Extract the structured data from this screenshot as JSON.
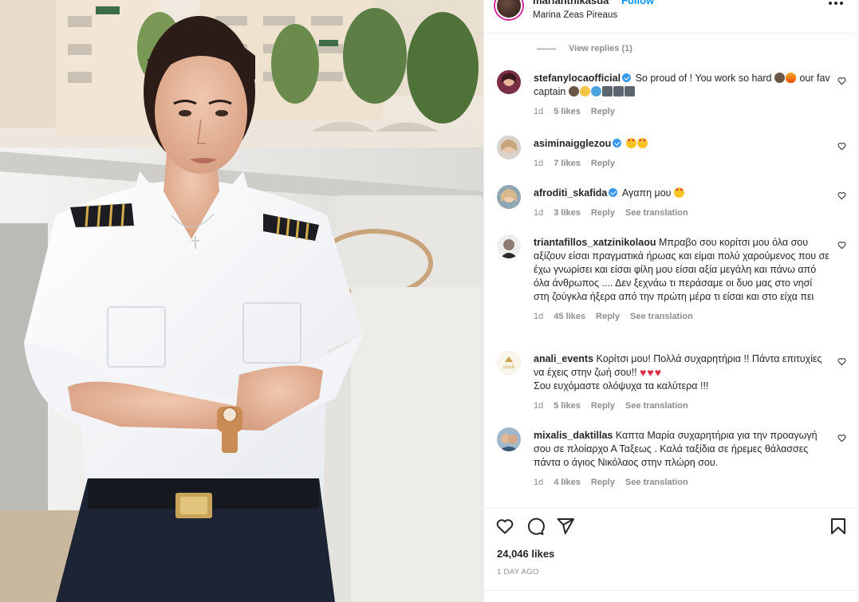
{
  "post": {
    "username": "marianthikasda",
    "follow_label": "Follow",
    "location": "Marina Zeas Pireaus"
  },
  "view_replies": "View replies (1)",
  "comments": [
    {
      "user": "stefanylocaofficial",
      "verified": true,
      "text": "So proud of ! You work so hard",
      "text_after": "our fav captain",
      "time": "1d",
      "likes": "5 likes",
      "reply": "Reply",
      "translation": ""
    },
    {
      "user": "asiminaigglezou",
      "verified": true,
      "text": "",
      "time": "1d",
      "likes": "7 likes",
      "reply": "Reply",
      "translation": ""
    },
    {
      "user": "afroditi_skafida",
      "verified": true,
      "text": "Αγαπη μου",
      "time": "1d",
      "likes": "3 likes",
      "reply": "Reply",
      "translation": "See translation"
    },
    {
      "user": "triantafillos_xatzinikolaou",
      "verified": false,
      "text": "Μπραβο σου κορίτσι μου όλα σου αξίζουν είσαι πραγματικά ήρωας και είμαι πολύ χαρούμενος που σε έχω γνωρίσει και είσαι φίλη μου είσαι αξία μεγάλη και πάνω από όλα άνθρωπος .... Δεν ξεχνάω τι περάσαμε οι δυο μας στο νησί στη ζούγκλα ήξερα από την πρώτη μέρα τι είσαι και στο είχα πει",
      "time": "1d",
      "likes": "45 likes",
      "reply": "Reply",
      "translation": "See translation"
    },
    {
      "user": "anali_events",
      "verified": false,
      "text": "Κορίτσι μου! Πολλά συχαρητήρια !! Πάντα επιτυχίες να έχεις στην ζωή σου!!",
      "text_line2": "Σου ευχόμαστε ολόψυχα τα καλύτερα !!!",
      "time": "1d",
      "likes": "5 likes",
      "reply": "Reply",
      "translation": "See translation"
    },
    {
      "user": "mixalis_daktillas",
      "verified": false,
      "text": "Καπτα Μαρία συχαρητήρια για την προαγωγή σου σε πλοίαρχο Α Ταξεως . Καλά ταξίδια σε ήρεμες θάλασσες πάντα ο άγιος Νικόλαος στην πλώρη σου.",
      "time": "1d",
      "likes": "4 likes",
      "reply": "Reply",
      "translation": "See translation"
    }
  ],
  "footer": {
    "likes": "24,046 likes",
    "posted": "1 DAY AGO"
  },
  "icons": {
    "like": "heart-icon",
    "comment": "comment-icon",
    "share": "send-icon",
    "save": "bookmark-icon",
    "more": "more-icon"
  },
  "colors": {
    "accent": "#0095f6",
    "verified": "#3897f0",
    "muted": "#8e8e8e",
    "text": "#262626"
  }
}
